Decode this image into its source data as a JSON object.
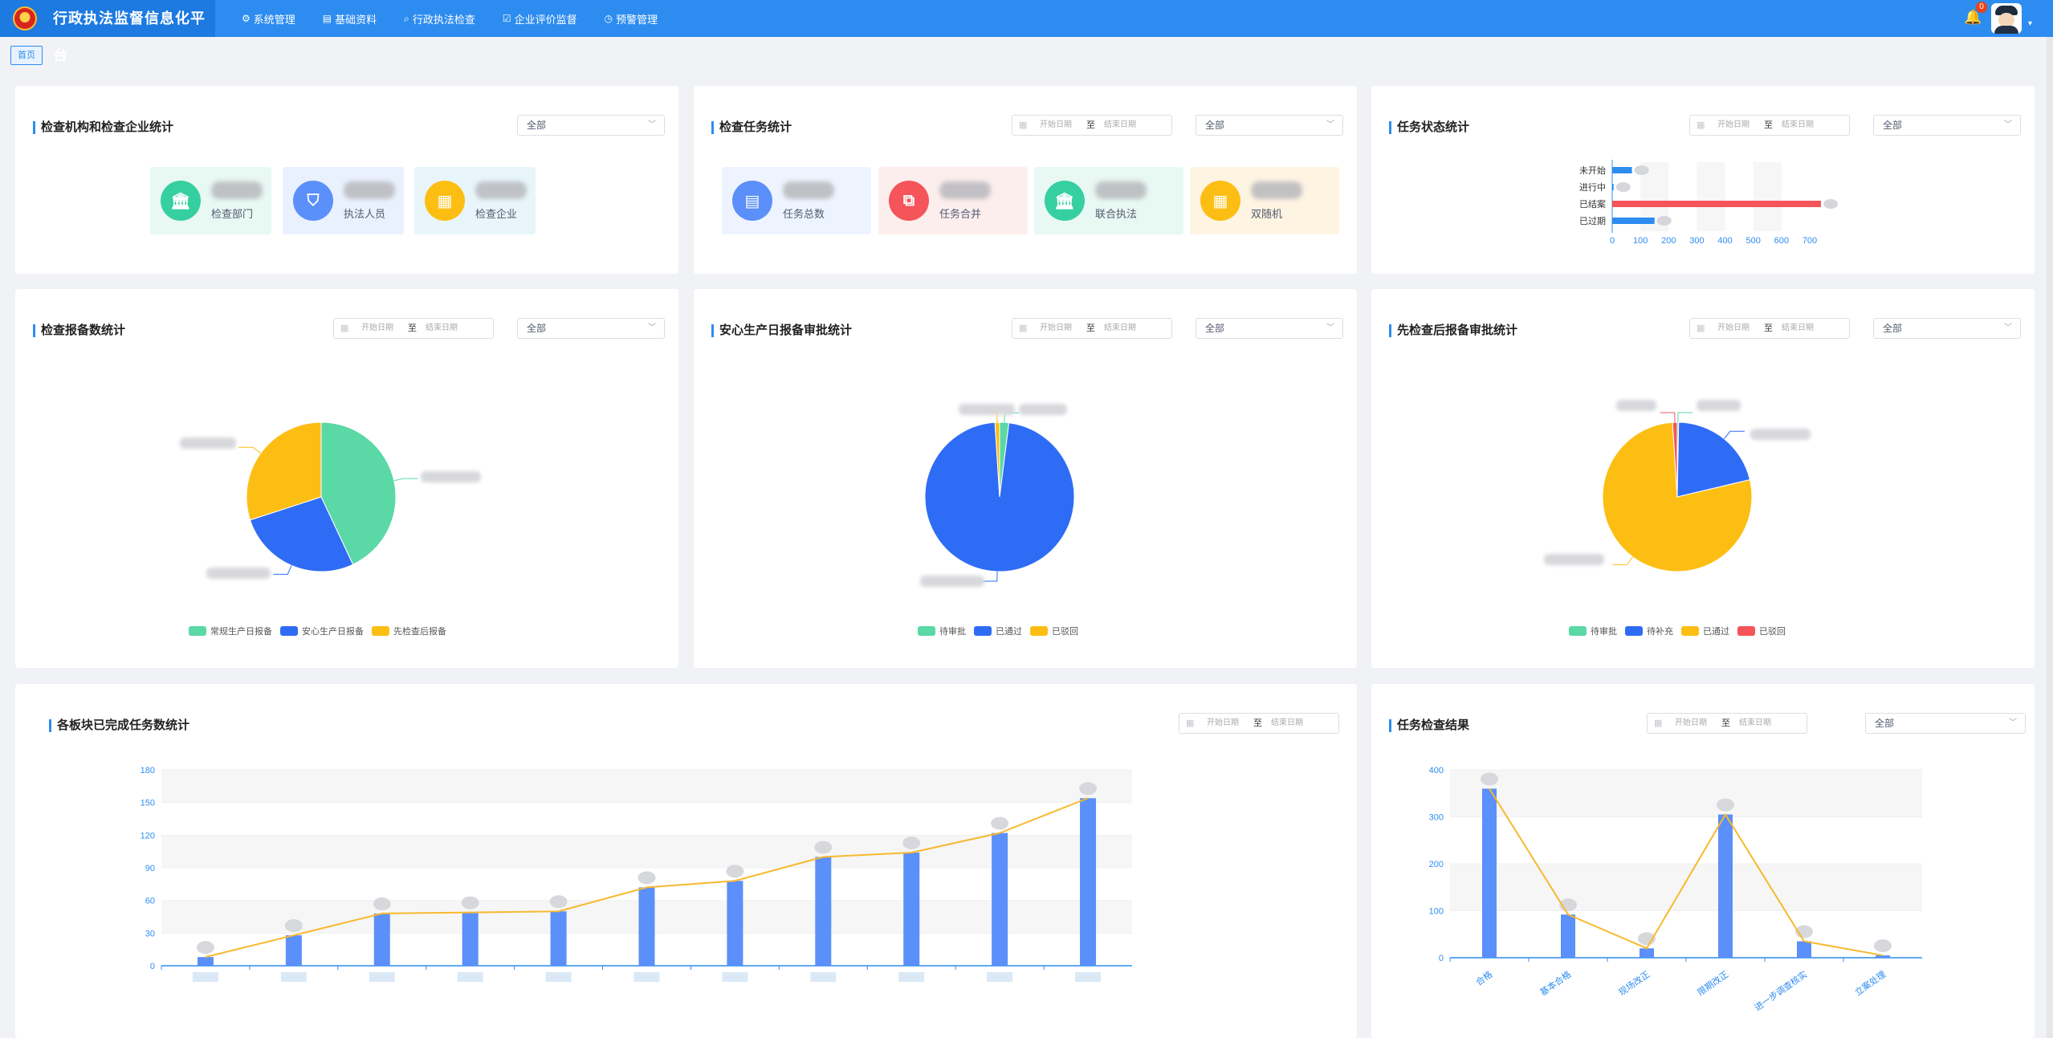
{
  "app": {
    "title": "行政执法监督信息化平台"
  },
  "nav": [
    {
      "label": "系统管理",
      "icon": "gear-icon",
      "glyph": "⚙"
    },
    {
      "label": "基础资料",
      "icon": "book-icon",
      "glyph": "▤"
    },
    {
      "label": "行政执法检查",
      "icon": "search-icon",
      "glyph": "⌕"
    },
    {
      "label": "企业评价监督",
      "icon": "check-square-icon",
      "glyph": "☑"
    },
    {
      "label": "预警管理",
      "icon": "clock-icon",
      "glyph": "◷"
    }
  ],
  "header": {
    "notification_count": "0"
  },
  "breadcrumb": {
    "home": "首页"
  },
  "common": {
    "select_all": "全部",
    "date_start_placeholder": "开始日期",
    "date_to": "至",
    "date_end_placeholder": "结束日期"
  },
  "colors": {
    "primary": "#2d8cf0",
    "green": "#5ad8a6",
    "blue": "#2f6cf5",
    "yellow": "#fdbe14",
    "red": "#f4545a",
    "bar": "#5b8ff9",
    "line": "#f7b92f"
  },
  "panels": {
    "org_stats": {
      "title": "检查机构和检查企业统计",
      "cards": [
        {
          "label": "检查部门",
          "icon": "bank-icon",
          "glyph": "🏛",
          "color": "#36cfa0",
          "bg": "#e8f8f3"
        },
        {
          "label": "执法人员",
          "icon": "police-icon",
          "glyph": "⛉",
          "color": "#5b8ff9",
          "bg": "#eaf1fe"
        },
        {
          "label": "检查企业",
          "icon": "building-icon",
          "glyph": "▦",
          "color": "#fdbe14",
          "bg": "#e8f6fb"
        }
      ]
    },
    "task_stats": {
      "title": "检查任务统计",
      "cards": [
        {
          "label": "任务总数",
          "icon": "document-icon",
          "glyph": "▤",
          "color": "#5b8ff9",
          "bg": "#eef4ff"
        },
        {
          "label": "任务合并",
          "icon": "merge-icon",
          "glyph": "⧉",
          "color": "#f4545a",
          "bg": "#fdeeee"
        },
        {
          "label": "联合执法",
          "icon": "bank-icon",
          "glyph": "🏛",
          "color": "#36cfa0",
          "bg": "#e8f8f2"
        },
        {
          "label": "双随机",
          "icon": "building-icon",
          "glyph": "▦",
          "color": "#fdbe14",
          "bg": "#fef4e2"
        }
      ]
    },
    "task_status": {
      "title": "任务状态统计"
    },
    "report_count": {
      "title": "检查报备数统计"
    },
    "safety_daily": {
      "title": "安心生产日报备审批统计"
    },
    "check_first": {
      "title": "先检查后报备审批统计"
    },
    "completed": {
      "title": "各板块已完成任务数统计"
    },
    "results": {
      "title": "任务检查结果"
    }
  },
  "chart_data": [
    {
      "id": "task_status",
      "type": "bar",
      "orientation": "horizontal",
      "categories": [
        "未开始",
        "进行中",
        "已结案",
        "已过期"
      ],
      "values": [
        70,
        5,
        740,
        150
      ],
      "xlim": [
        0,
        700
      ],
      "xticks": [
        0,
        100,
        200,
        300,
        400,
        500,
        600,
        700
      ]
    },
    {
      "id": "report_count",
      "type": "pie",
      "labels": [
        "常规生产日报备",
        "安心生产日报备",
        "先检查后报备"
      ],
      "values": [
        43,
        27,
        30
      ],
      "colors": [
        "#5ad8a6",
        "#2f6cf5",
        "#fdbe14"
      ],
      "legend": "bottom"
    },
    {
      "id": "safety_daily",
      "type": "pie",
      "labels": [
        "待审批",
        "已通过",
        "已驳回"
      ],
      "values": [
        2,
        97,
        1
      ],
      "colors": [
        "#5ad8a6",
        "#2f6cf5",
        "#fdbe14"
      ],
      "legend": "bottom"
    },
    {
      "id": "check_first",
      "type": "pie",
      "labels": [
        "待审批",
        "待补充",
        "已通过",
        "已驳回"
      ],
      "values": [
        0.3,
        21,
        77.7,
        1
      ],
      "colors": [
        "#5ad8a6",
        "#2f6cf5",
        "#fdbe14",
        "#f4545a"
      ],
      "legend": "bottom"
    },
    {
      "id": "completed",
      "type": "bar+line",
      "values": [
        8,
        28,
        48,
        49,
        50,
        72,
        78,
        100,
        104,
        122,
        154
      ],
      "ylim": [
        0,
        180
      ],
      "yticks": [
        0,
        30,
        60,
        90,
        120,
        150,
        180
      ]
    },
    {
      "id": "results",
      "type": "bar+line",
      "categories": [
        "合格",
        "基本合格",
        "现场改正",
        "限期改正",
        "进一步调查核实",
        "立案处理"
      ],
      "values": [
        360,
        92,
        20,
        305,
        35,
        5
      ],
      "ylim": [
        0,
        400
      ],
      "yticks": [
        0,
        100,
        200,
        300,
        400
      ]
    }
  ]
}
